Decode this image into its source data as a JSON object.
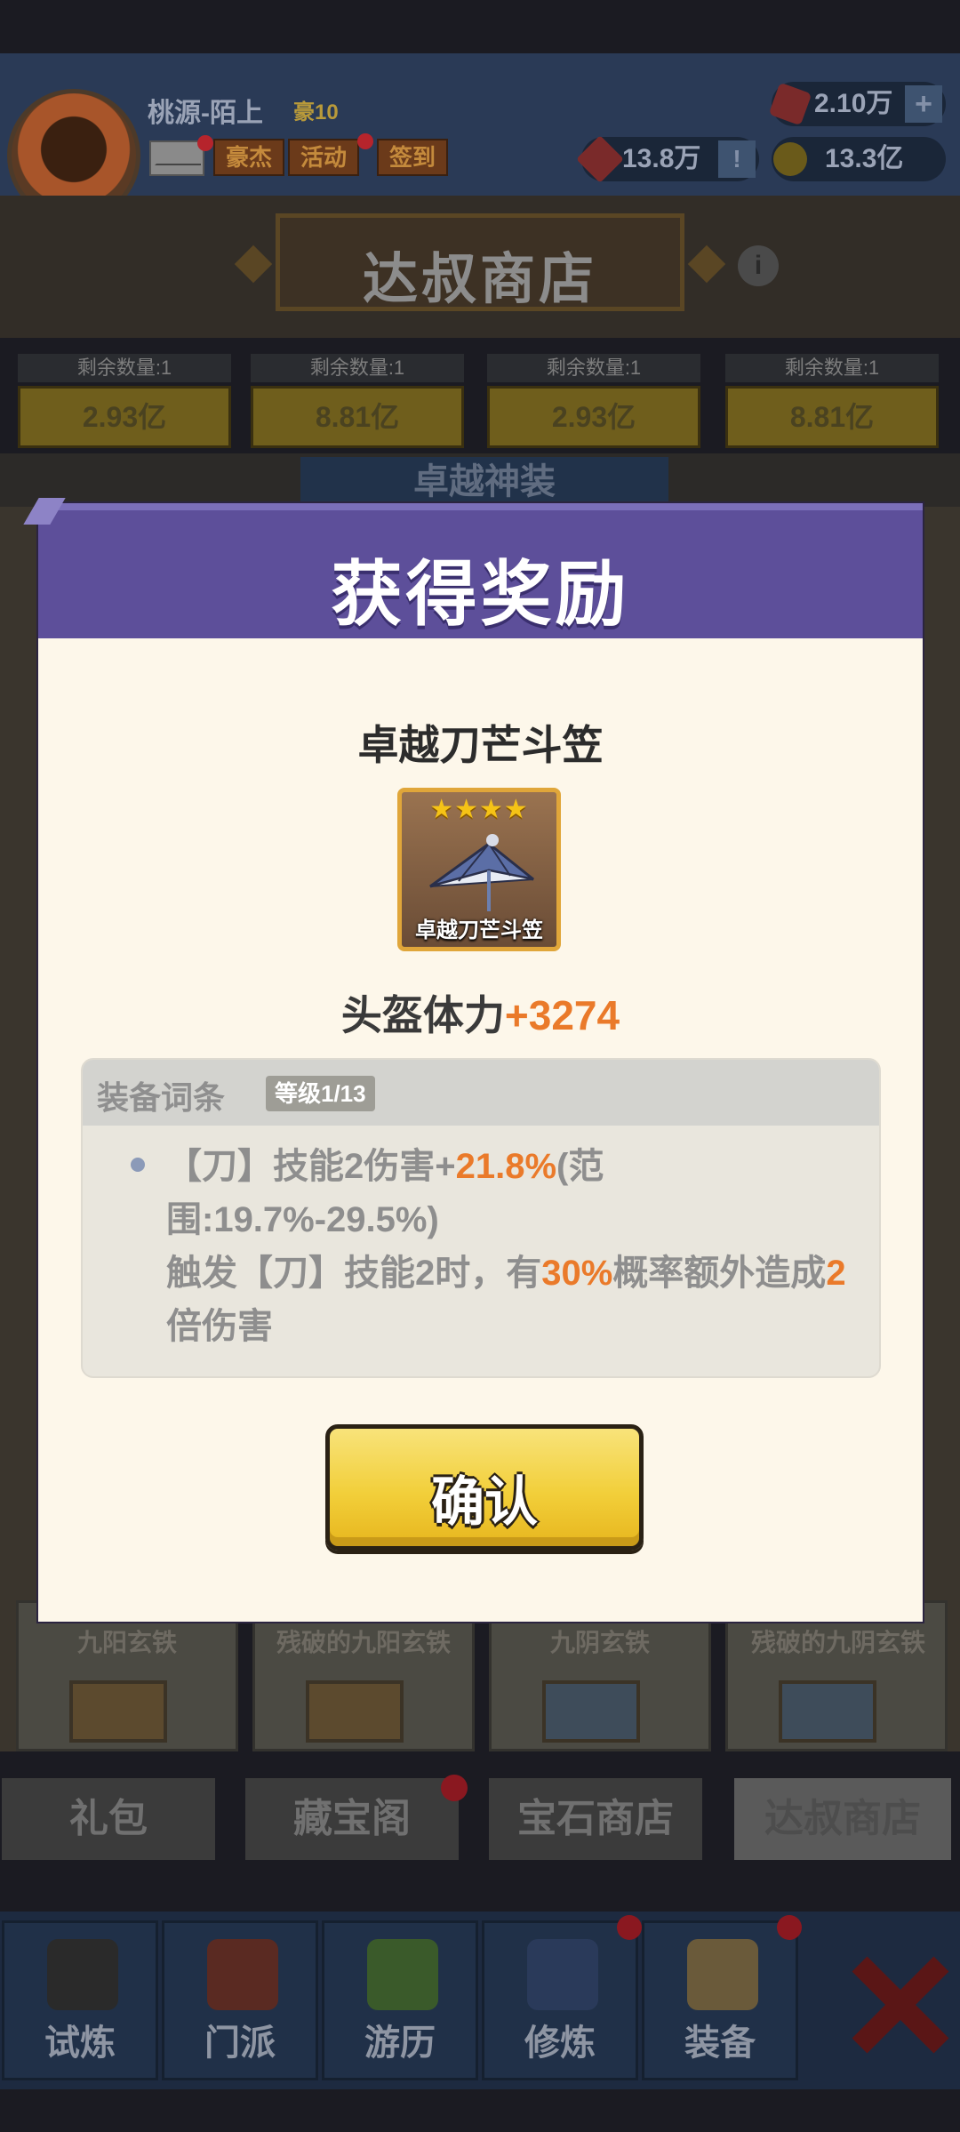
{
  "player": {
    "name": "桃源-陌上",
    "vip": "豪10",
    "buttons": [
      "豪杰",
      "活动",
      "签到"
    ]
  },
  "currency": {
    "gems": "2.10万",
    "tickets": "13.8万",
    "coins": "13.3亿",
    "plus": "+",
    "alert": "!"
  },
  "shop": {
    "title": "达叔商店",
    "info": "i",
    "slots": [
      {
        "remain": "剩余数量:1",
        "price": "2.93亿"
      },
      {
        "remain": "剩余数量:1",
        "price": "8.81亿"
      },
      {
        "remain": "剩余数量:1",
        "price": "2.93亿"
      },
      {
        "remain": "剩余数量:1",
        "price": "8.81亿"
      }
    ],
    "section_peek": "卓越神装",
    "items": [
      "九阳玄铁",
      "残破的九阳玄铁",
      "九阴玄铁",
      "残破的九阴玄铁"
    ],
    "tabs": [
      "礼包",
      "藏宝阁",
      "宝石商店",
      "达叔商店"
    ]
  },
  "nav": {
    "items": [
      "试炼",
      "门派",
      "游历",
      "修炼",
      "装备"
    ]
  },
  "reward": {
    "title": "获得奖励",
    "item_name": "卓越刀芒斗笠",
    "stars": "★★★★",
    "icon_label": "卓越刀芒斗笠",
    "stat_label": "头盔体力",
    "stat_value": "+3274",
    "attr_title": "装备词条",
    "attr_level": "等级1/13",
    "attr": {
      "p1": "【刀】技能2伤害+",
      "v1": "21.8%",
      "p2": "(范围:19.7%-29.5%)",
      "p3": "触发【刀】技能2时，有",
      "v2": "30%",
      "p4": "概率额外造成",
      "v3": "2",
      "p5": "倍伤害"
    },
    "confirm": "确认"
  },
  "colors": {
    "modal_header": "#5d4f9a",
    "modal_body": "#fdf7ea",
    "highlight": "#ea7a2a",
    "button_gold": "#f2cf3a"
  }
}
